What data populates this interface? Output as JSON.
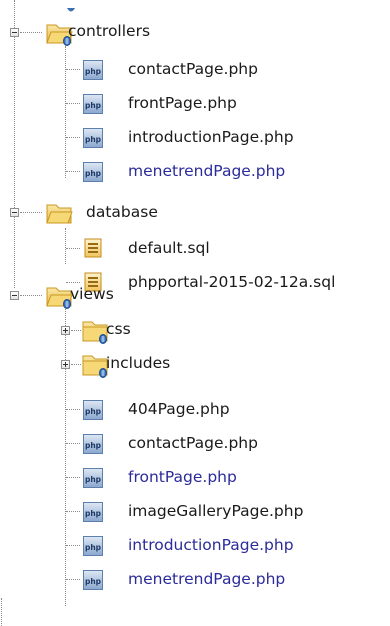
{
  "tree": {
    "controllers": {
      "label": "controllers",
      "files": [
        {
          "label": "contactPage.php",
          "modified": false
        },
        {
          "label": "frontPage.php",
          "modified": false
        },
        {
          "label": "introductionPage.php",
          "modified": false
        },
        {
          "label": "menetrendPage.php",
          "modified": true
        }
      ]
    },
    "database": {
      "label": "database",
      "files": [
        {
          "label": "default.sql"
        },
        {
          "label": "phpportal-2015-02-12a.sql"
        }
      ]
    },
    "views": {
      "label": "views",
      "folders": [
        {
          "label": "css"
        },
        {
          "label": "includes"
        }
      ],
      "files": [
        {
          "label": "404Page.php",
          "modified": false
        },
        {
          "label": "contactPage.php",
          "modified": false
        },
        {
          "label": "frontPage.php",
          "modified": true
        },
        {
          "label": "imageGalleryPage.php",
          "modified": false
        },
        {
          "label": "introductionPage.php",
          "modified": true
        },
        {
          "label": "menetrendPage.php",
          "modified": true
        }
      ]
    }
  },
  "colors": {
    "modified_text": "#2b2b9a",
    "normal_text": "#1a1a1a",
    "folder": "#f2cc5a",
    "php_icon": "#6b8fbf",
    "sql_icon": "#e8b64a"
  },
  "icon_text": {
    "php": "php"
  }
}
